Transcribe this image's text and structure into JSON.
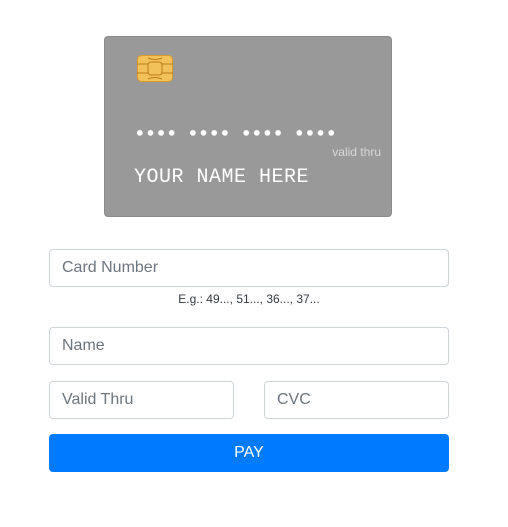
{
  "card": {
    "number_mask": "•••• •••• •••• ••••",
    "valid_thru_label": "valid thru",
    "name_placeholder": "YOUR NAME HERE",
    "background_color": "#999999",
    "chip_color": "#f2c15a"
  },
  "form": {
    "card_number": {
      "placeholder": "Card Number",
      "value": ""
    },
    "card_number_hint": "E.g.: 49..., 51..., 36..., 37...",
    "name": {
      "placeholder": "Name",
      "value": ""
    },
    "valid_thru": {
      "placeholder": "Valid Thru",
      "value": ""
    },
    "cvc": {
      "placeholder": "CVC",
      "value": ""
    },
    "pay_button_label": "PAY",
    "pay_button_color": "#007bff"
  }
}
